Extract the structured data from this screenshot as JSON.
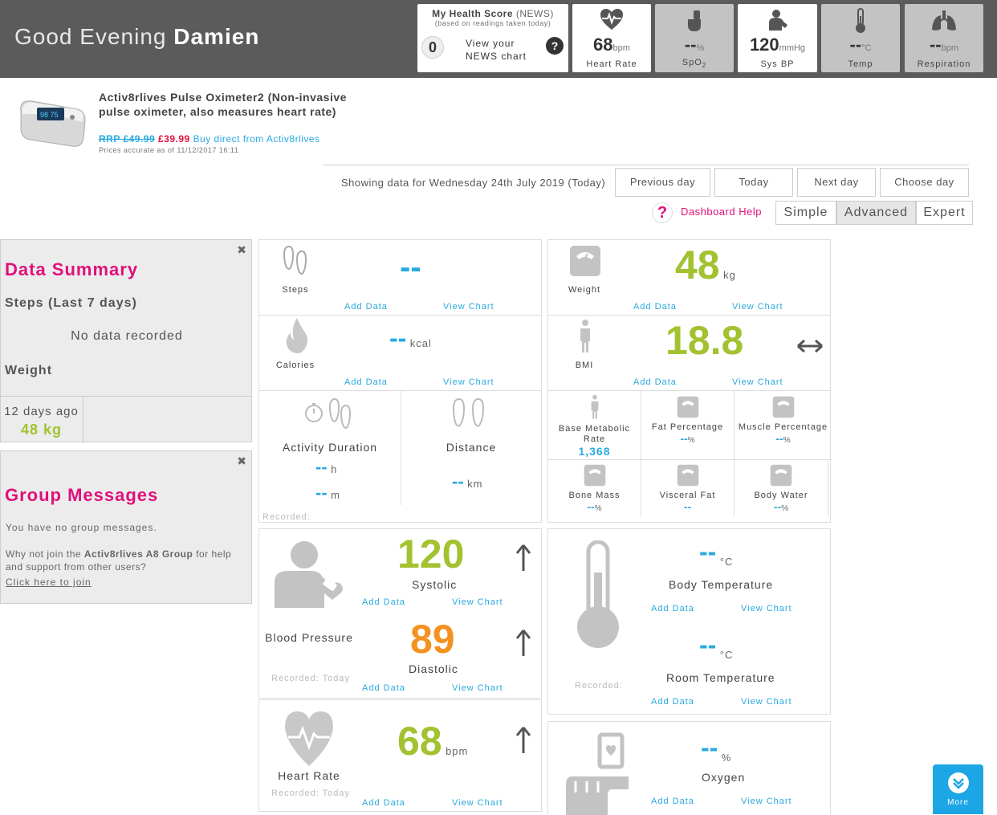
{
  "header": {
    "greeting": "Good Evening",
    "user_name": "Damien",
    "news": {
      "title": "My Health Score",
      "title_suffix": "(NEWS)",
      "subtitle": "(based on readings taken today)",
      "score": "0",
      "link_line1": "View your",
      "link_line2": "NEWS chart",
      "help": "?"
    },
    "vitals": [
      {
        "value": "68",
        "unit": "bpm",
        "label": "Heart Rate",
        "icon": "heart-rate-icon"
      },
      {
        "value": "--",
        "unit": "%",
        "label": "SpO",
        "label_sub": "2",
        "icon": "spo2-icon"
      },
      {
        "value": "120",
        "unit": "mmHg",
        "label": "Sys BP",
        "icon": "blood-pressure-icon"
      },
      {
        "value": "--",
        "unit": "°C",
        "label": "Temp",
        "icon": "thermometer-icon"
      },
      {
        "value": "--",
        "unit": "bpm",
        "label": "Respiration",
        "icon": "lungs-icon"
      }
    ]
  },
  "ad": {
    "name": "Activ8rlives Pulse Oximeter2 (Non-invasive pulse oximeter, also measures heart rate)",
    "rrp": "RRP £49.99",
    "price": "£39.99",
    "buy": "Buy direct from Activ8rlives",
    "note": "Prices accurate as of 11/12/2017 16:11"
  },
  "date_nav": {
    "showing": "Showing data for Wednesday 24th July 2019 (Today)",
    "prev": "Previous day",
    "today": "Today",
    "next": "Next day",
    "choose": "Choose day"
  },
  "mode": {
    "help": "Dashboard Help",
    "simple": "Simple",
    "advanced": "Advanced",
    "expert": "Expert",
    "active": "advanced"
  },
  "summary": {
    "title": "Data Summary",
    "steps_heading": "Steps (Last 7 days)",
    "steps_empty": "No data recorded",
    "weight_heading": "Weight",
    "weight_when": "12 days ago",
    "weight_value": "48 kg"
  },
  "group": {
    "title": "Group Messages",
    "none": "You have no group messages.",
    "join_pre": "Why not join the",
    "join_group": "Activ8rlives A8 Group",
    "join_post": "for help and support from other users?",
    "join_link": "Click here to join"
  },
  "tiles": {
    "add": "Add Data",
    "view": "View Chart",
    "recorded": "Recorded:",
    "recorded_today": "Recorded: Today",
    "steps": {
      "label": "Steps",
      "value": "--"
    },
    "calories": {
      "label": "Calories",
      "value": "--",
      "unit": "kcal"
    },
    "activity": {
      "label": "Activity Duration",
      "h": "--",
      "h_unit": "h",
      "m": "--",
      "m_unit": "m"
    },
    "distance": {
      "label": "Distance",
      "value": "--",
      "unit": "km"
    },
    "weight": {
      "label": "Weight",
      "value": "48",
      "unit": "kg"
    },
    "bmi": {
      "label": "BMI",
      "value": "18.8"
    },
    "bmr": {
      "label": "Base Metabolic Rate",
      "value": "1,368"
    },
    "fat": {
      "label": "Fat Percentage",
      "value": "--",
      "unit": "%"
    },
    "muscle": {
      "label": "Muscle Percentage",
      "value": "--",
      "unit": "%"
    },
    "bone": {
      "label": "Bone Mass",
      "value": "--",
      "unit": "%"
    },
    "visceral": {
      "label": "Visceral Fat",
      "value": "--"
    },
    "water": {
      "label": "Body Water",
      "value": "--",
      "unit": "%"
    },
    "bp": {
      "label": "Blood Pressure",
      "sys": "120",
      "sys_label": "Systolic",
      "dia": "89",
      "dia_label": "Diastolic"
    },
    "hr": {
      "label": "Heart Rate",
      "value": "68",
      "unit": "bpm"
    },
    "temp": {
      "body_value": "--",
      "unit": "°C",
      "body_label": "Body Temperature",
      "room_value": "--",
      "room_label": "Room Temperature"
    },
    "oxygen": {
      "value": "--",
      "unit": "%",
      "label": "Oxygen"
    }
  },
  "more": {
    "label": "More"
  },
  "colors": {
    "accent": "#e0107a",
    "link": "#29a9e0",
    "good": "#a2c230",
    "warn": "#f39221",
    "header": "#5b5b5b"
  }
}
